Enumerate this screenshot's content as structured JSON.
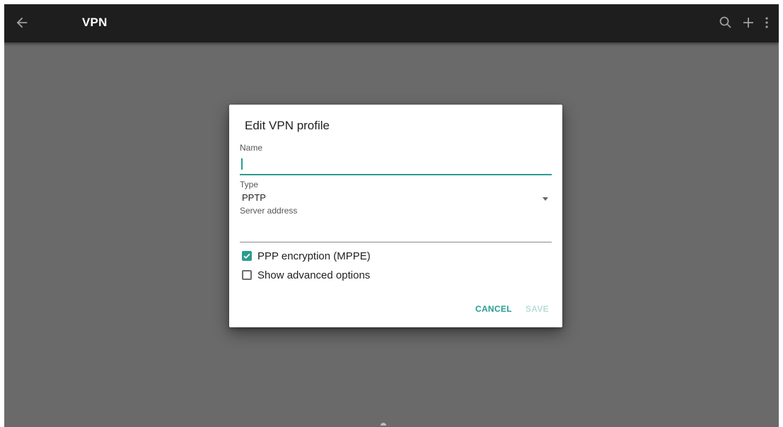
{
  "appbar": {
    "title": "VPN",
    "back_icon": "arrow-left-icon",
    "actions": [
      "search-icon",
      "add-icon",
      "more-vert-icon"
    ],
    "background": "#1e1e1e"
  },
  "dialog": {
    "title": "Edit VPN profile",
    "name": {
      "label": "Name",
      "value": ""
    },
    "type": {
      "label": "Type",
      "value": "PPTP"
    },
    "server": {
      "label": "Server address",
      "value": ""
    },
    "mppe": {
      "label": "PPP encryption (MPPE)",
      "checked": true
    },
    "advanced": {
      "label": "Show advanced options",
      "checked": false
    },
    "buttons": {
      "cancel": "CANCEL",
      "save": "SAVE"
    }
  },
  "colors": {
    "accent": "#2a9d8f",
    "disabled_accent": "#b7ddd8",
    "scrim": "#6a6a6a"
  }
}
